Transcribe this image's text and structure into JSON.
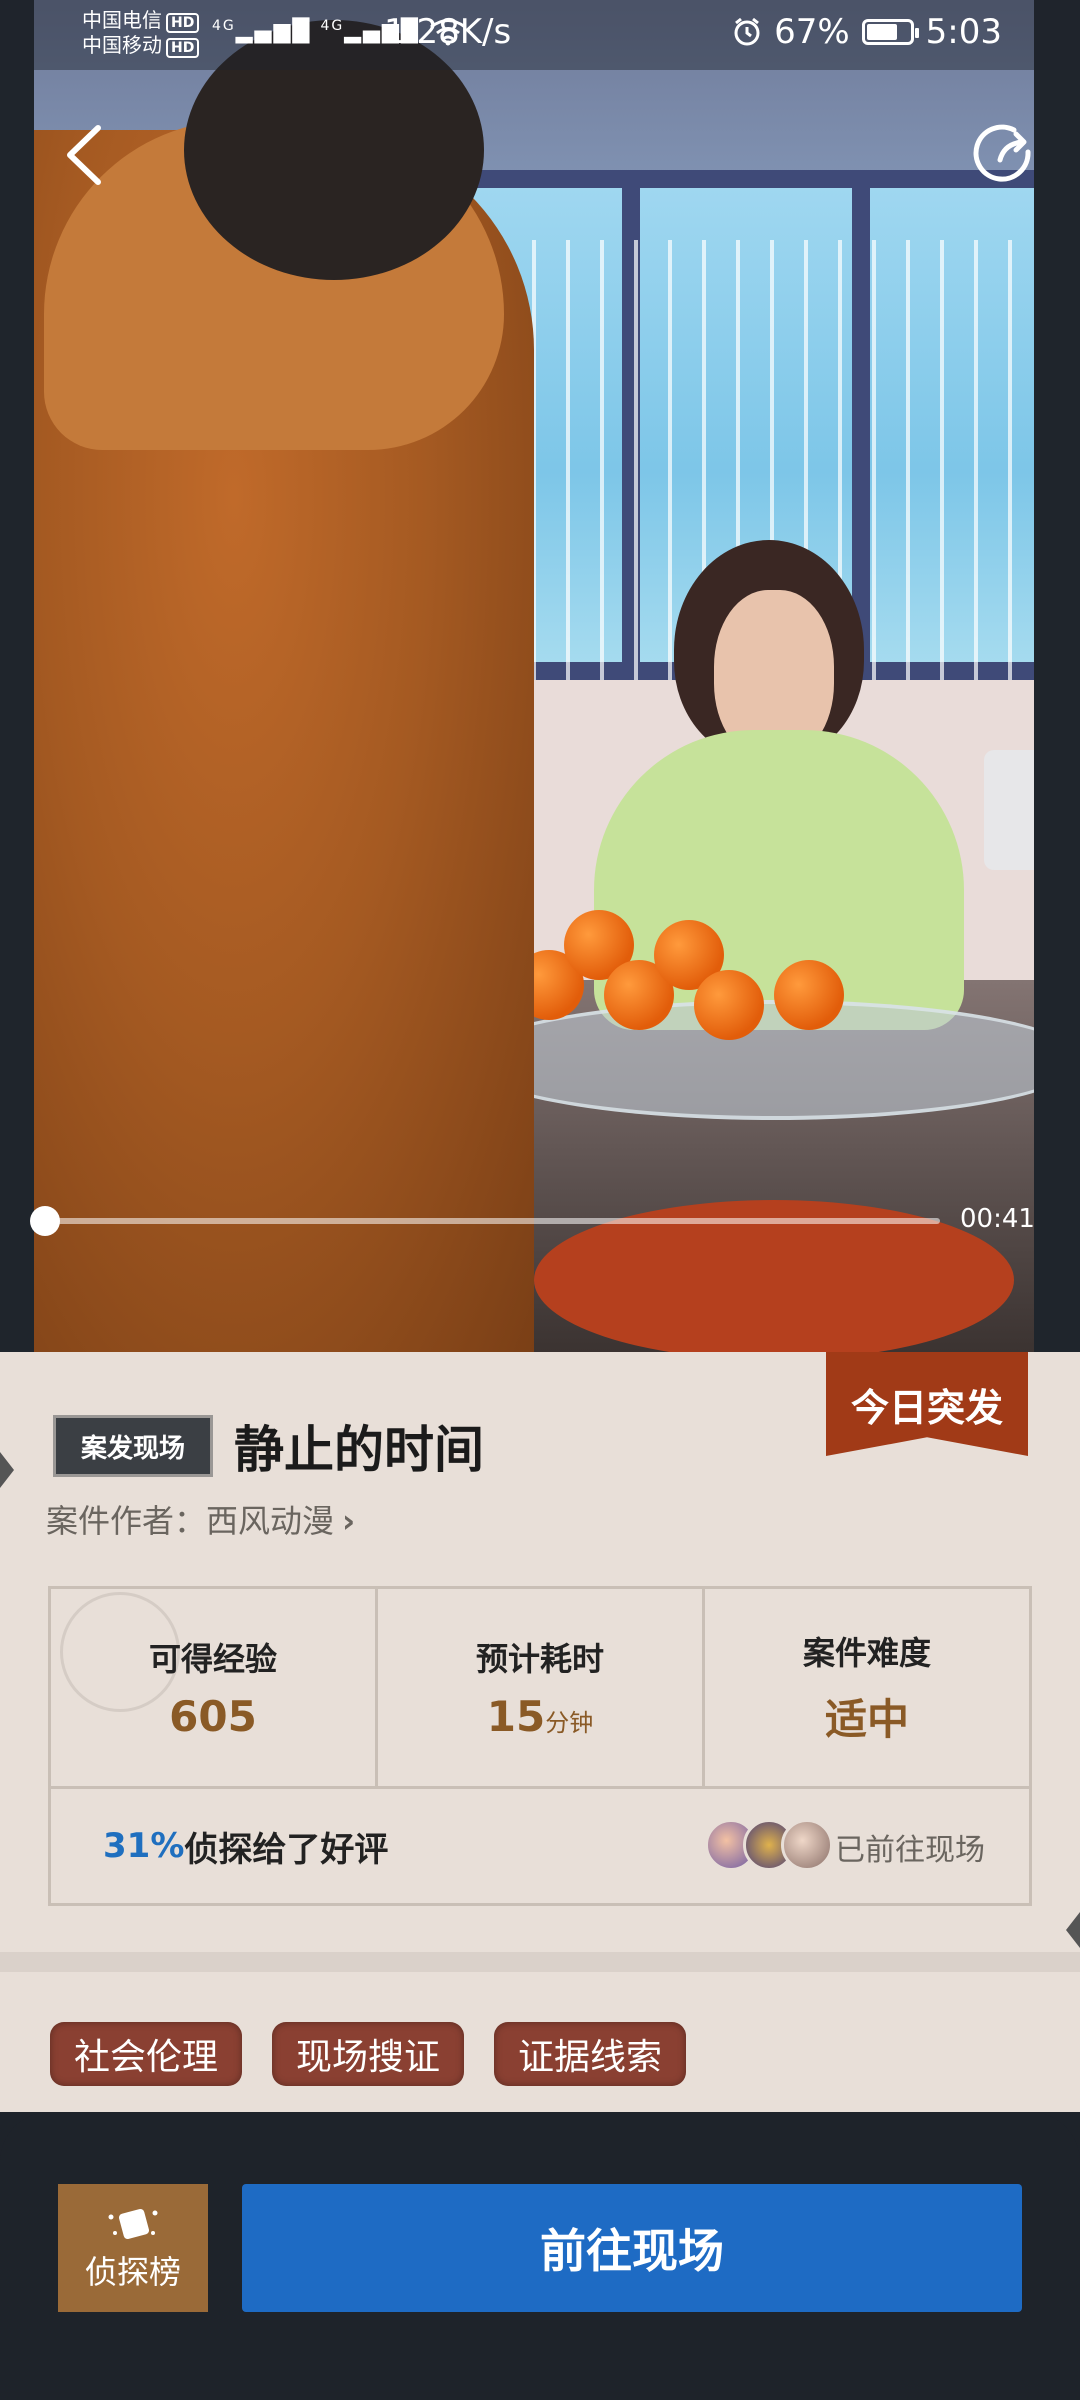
{
  "status_bar": {
    "carrier_1": "中国电信",
    "carrier_2": "中国移动",
    "hd": "HD",
    "net_1": "4G",
    "net_2": "4G",
    "net_speed": "1.28K/s",
    "battery": "67%",
    "time": "5:03"
  },
  "video": {
    "duration": "00:41",
    "progress_fraction": 0.0,
    "icons": {
      "back": "back-arrow-icon",
      "share": "share-icon"
    }
  },
  "case": {
    "ribbon": "今日突发",
    "tag": "案发现场",
    "title": "静止的时间",
    "author_label": "案件作者：西风动漫",
    "chevron": "›",
    "stats": [
      {
        "label": "可得经验",
        "value": "605",
        "unit": ""
      },
      {
        "label": "预计耗时",
        "value": "15",
        "unit": "分钟"
      },
      {
        "label": "案件难度",
        "value": "适中",
        "unit": ""
      }
    ],
    "rating_pct": "31%",
    "rating_text": "侦探给了好评",
    "visited": "已前往现场",
    "tags": [
      "社会伦理",
      "现场搜证",
      "证据线索"
    ]
  },
  "bottom": {
    "rank_label": "侦探榜",
    "go_label": "前往现场"
  },
  "colors": {
    "accent_blue": "#1e6bc4",
    "ribbon_red": "#a13a17",
    "value_brown": "#8a5a26",
    "tag_red": "#8a4032",
    "rank_brown": "#9a6a38"
  }
}
